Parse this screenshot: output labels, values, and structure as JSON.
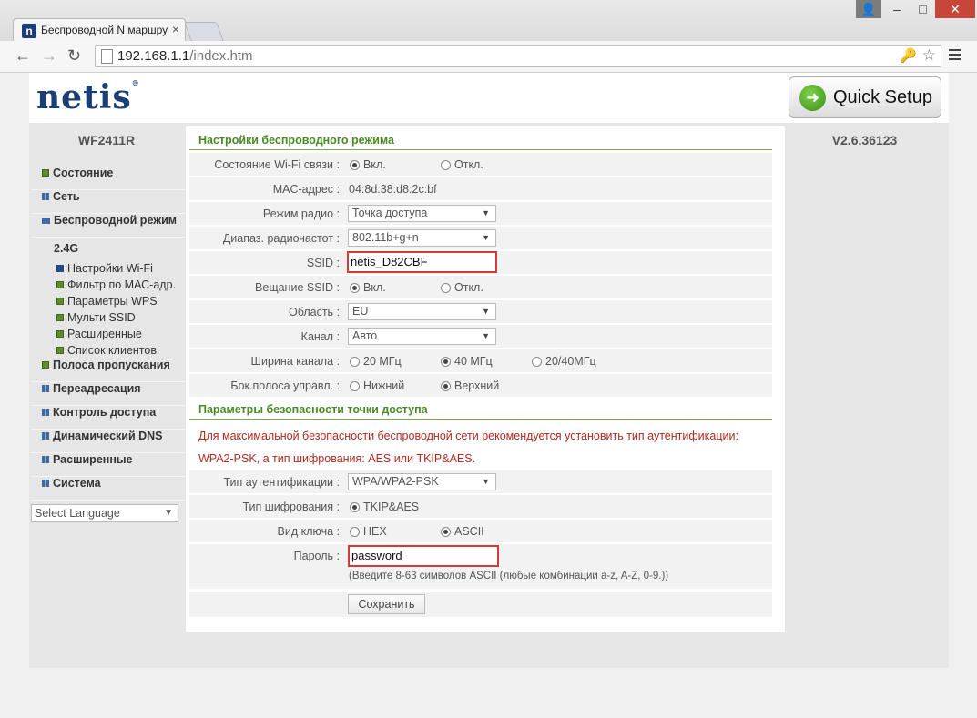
{
  "browser": {
    "tab_title": "Беспроводной N маршру",
    "tab_close": "×",
    "favicon_letter": "n",
    "url_host": "192.168.1.1",
    "url_path": "/index.htm",
    "window_buttons": {
      "user": "👤",
      "minimize": "–",
      "maximize": "□",
      "close": "✕"
    },
    "nav": {
      "back": "←",
      "forward": "→",
      "reload": "↻"
    },
    "key_icon": "🔑",
    "star_icon": "☆"
  },
  "header": {
    "logo": "netis",
    "logo_mark": "®",
    "quick_setup": "Quick Setup",
    "model": "WF2411R",
    "version": "V2.6.36123"
  },
  "sidebar": {
    "items": [
      {
        "label": "Состояние",
        "bullet": "green"
      },
      {
        "label": "Сеть",
        "bullet": "grid"
      },
      {
        "label": "Беспроводной режим",
        "bullet": "open"
      }
    ],
    "band": "2.4G",
    "subitems": [
      {
        "label": "Настройки Wi-Fi",
        "active": true
      },
      {
        "label": "Фильтр по МАС-адр.",
        "active": false
      },
      {
        "label": "Параметры WPS",
        "active": false
      },
      {
        "label": "Мульти SSID",
        "active": false
      },
      {
        "label": "Расширенные",
        "active": false
      },
      {
        "label": "Список клиентов",
        "active": false
      }
    ],
    "items_after": [
      {
        "label": "Полоса пропускания",
        "bullet": "green"
      },
      {
        "label": "Переадресация",
        "bullet": "grid"
      },
      {
        "label": "Контроль доступа",
        "bullet": "grid"
      },
      {
        "label": "Динамический DNS",
        "bullet": "grid"
      },
      {
        "label": "Расширенные",
        "bullet": "grid"
      },
      {
        "label": "Система",
        "bullet": "grid"
      }
    ],
    "language": "Select Language"
  },
  "wireless": {
    "title": "Настройки беспроводного режима",
    "wifi_status_label": "Состояние Wi-Fi связи :",
    "on": "Вкл.",
    "off": "Откл.",
    "mac_label": "MAC-адрес :",
    "mac": "04:8d:38:d8:2c:bf",
    "radio_mode_label": "Режим радио :",
    "radio_mode": "Точка доступа",
    "band_label": "Диапаз. радиочастот :",
    "band": "802.11b+g+n",
    "ssid_label": "SSID :",
    "ssid": "netis_D82CBF",
    "broadcast_label": "Вещание SSID :",
    "region_label": "Область :",
    "region": "EU",
    "channel_label": "Канал :",
    "channel": "Авто",
    "width_label": "Ширина канала :",
    "width_20": "20 МГц",
    "width_40": "40 МГц",
    "width_2040": "20/40МГц",
    "sideband_label": "Бок.полоса управл. :",
    "lower": "Нижний",
    "upper": "Верхний"
  },
  "security": {
    "title": "Параметры безопасности точки доступа",
    "warning_1": "Для максимальной безопасности беспроводной сети рекомендуется установить тип аутентификации:",
    "warning_2": "WPA2-PSK, а тип шифрования: AES или TKIP&AES.",
    "auth_label": "Тип аутентификации :",
    "auth": "WPA/WPA2-PSK",
    "cipher_label": "Тип шифрования :",
    "cipher": "TKIP&AES",
    "key_type_label": "Вид ключа :",
    "hex": "HEX",
    "ascii": "ASCII",
    "password_label": "Пароль :",
    "password": "password",
    "hint": "(Введите 8-63 символов ASCII (любые комбинации a-z, A-Z, 0-9.))",
    "save": "Сохранить"
  },
  "icons": [
    "user-icon",
    "minimize-icon",
    "maximize-icon",
    "close-icon",
    "back-icon",
    "forward-icon",
    "reload-icon",
    "page-icon",
    "key-icon",
    "star-icon",
    "menu-icon",
    "quick-setup-icon",
    "chevron-down-icon"
  ]
}
